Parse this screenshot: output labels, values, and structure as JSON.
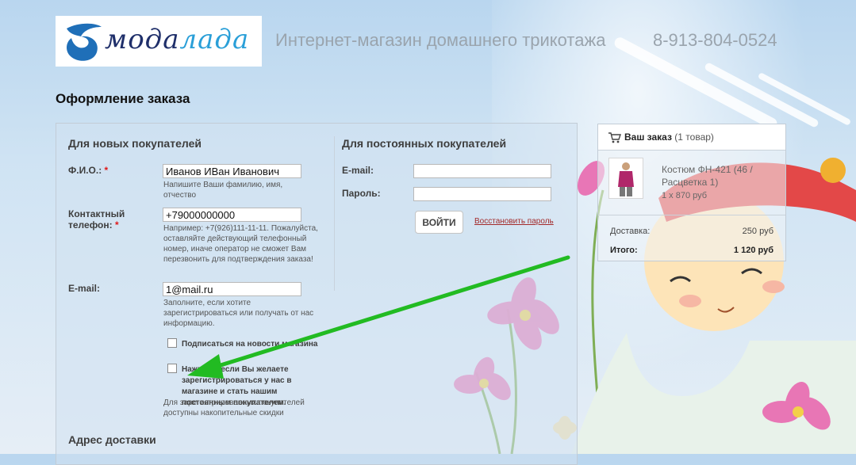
{
  "brand": {
    "logo_text_a": "мода",
    "logo_text_b": "лада",
    "tagline": "Интернет-магазин домашнего трикотажа",
    "phone": "8-913-804-0524"
  },
  "page_title": "Оформление заказа",
  "new_customers": {
    "title": "Для новых покупателей",
    "required_mark": "*",
    "fio": {
      "label": "Ф.И.О.:",
      "value": "Иванов ИВан Иванович",
      "hint": "Напишите Ваши фамилию, имя, отчество"
    },
    "phone": {
      "label": "Контактный телефон:",
      "value": "+79000000000",
      "hint": "Например: +7(926)111-11-11. Пожалуйста, оставляйте действующий телефонный номер, иначе оператор не сможет Вам перезвонить для подтверждения заказа!"
    },
    "email": {
      "label": "E-mail:",
      "value": "1@mail.ru",
      "hint": "Заполните, если хотите зарегистрироваться или получать от нас информацию."
    },
    "subscribe_label": "Подписаться на новости магазина",
    "register_label": "Нажмите, если Вы желаете зарегистрироваться у нас в магазине и стать нашим постоянным покупателем.",
    "register_note": "Для зарегистрированных покупателей доступны накопительные скидки"
  },
  "returning_customers": {
    "title": "Для постоянных покупателей",
    "email_label": "E-mail:",
    "email_value": "",
    "password_label": "Пароль:",
    "password_value": "",
    "login_button": "ВОЙТИ",
    "restore_link": "Восстановить пароль"
  },
  "delivery_section_title": "Адрес доставки",
  "cart": {
    "icon": "cart-icon",
    "title": "Ваш заказ",
    "count": "(1 товар)",
    "item_name": "Костюм ФН-421 (46 / Расцветка 1)",
    "item_qty": "1 х 870 руб",
    "delivery_label": "Доставка:",
    "delivery_value": "250 руб",
    "total_label": "Итого:",
    "total_value": "1 120 руб"
  },
  "colors": {
    "arrow": "#22bb22",
    "required": "#e01818",
    "brand_dark": "#1f2f6a",
    "brand_light": "#2a9fd8"
  }
}
